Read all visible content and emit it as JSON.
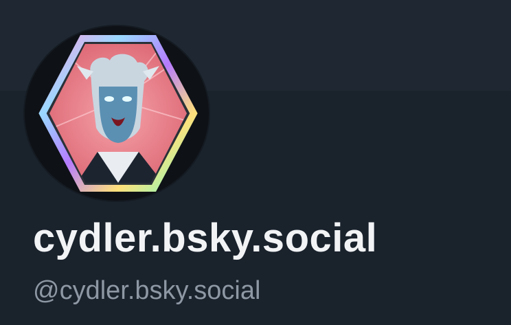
{
  "profile": {
    "display_name": "cydler.bsky.social",
    "handle": "@cydler.bsky.social",
    "avatar_icon": "hexagon-character-portrait-icon"
  },
  "colors": {
    "background": "#1a222c",
    "banner": "#1f2832",
    "display_name_text": "#f1f3f5",
    "handle_text": "#8d98a4",
    "avatar_pink": "#e87a86"
  }
}
